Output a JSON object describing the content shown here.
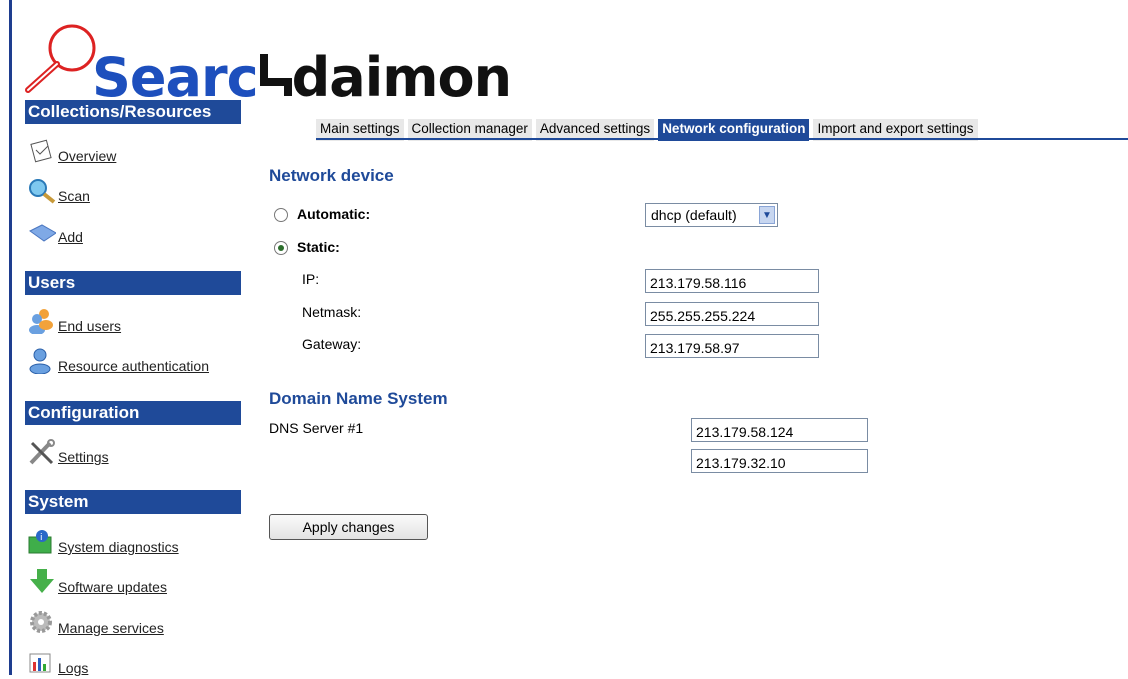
{
  "brand": {
    "part1": "Searc",
    "part2": "daimon"
  },
  "sidebar": {
    "sections": [
      {
        "title": "Collections/Resources",
        "items": [
          {
            "label": "Overview",
            "icon": "clipboard-icon"
          },
          {
            "label": "Scan",
            "icon": "magnifier-icon"
          },
          {
            "label": "Add",
            "icon": "diamond-icon"
          }
        ]
      },
      {
        "title": "Users",
        "items": [
          {
            "label": "End users",
            "icon": "users-icon"
          },
          {
            "label": "Resource authentication",
            "icon": "user-icon"
          }
        ]
      },
      {
        "title": "Configuration",
        "items": [
          {
            "label": "Settings",
            "icon": "tools-icon"
          }
        ]
      },
      {
        "title": "System",
        "items": [
          {
            "label": "System diagnostics",
            "icon": "diagnostics-icon"
          },
          {
            "label": "Software updates",
            "icon": "download-arrow-icon"
          },
          {
            "label": "Manage services",
            "icon": "gear-icon"
          },
          {
            "label": "Logs",
            "icon": "bar-chart-icon"
          }
        ]
      }
    ]
  },
  "tabs": [
    {
      "label": "Main settings",
      "active": false
    },
    {
      "label": "Collection manager",
      "active": false
    },
    {
      "label": "Advanced settings",
      "active": false
    },
    {
      "label": "Network configuration",
      "active": true
    },
    {
      "label": "Import and export settings",
      "active": false
    }
  ],
  "network": {
    "heading": "Network device",
    "automatic_label": "Automatic:",
    "static_label": "Static:",
    "mode_selected": "static",
    "dhcp_select_value": "dhcp (default)",
    "ip_label": "IP:",
    "ip_value": "213.179.58.116",
    "netmask_label": "Netmask:",
    "netmask_value": "255.255.255.224",
    "gateway_label": "Gateway:",
    "gateway_value": "213.179.58.97"
  },
  "dns": {
    "heading": "Domain Name System",
    "server1_label": "DNS Server #1",
    "server1_value": "213.179.58.124",
    "server2_value": "213.179.32.10"
  },
  "apply_label": "Apply changes",
  "colors": {
    "accent": "#1f4a99",
    "brand_blue": "#1d4fbd"
  }
}
